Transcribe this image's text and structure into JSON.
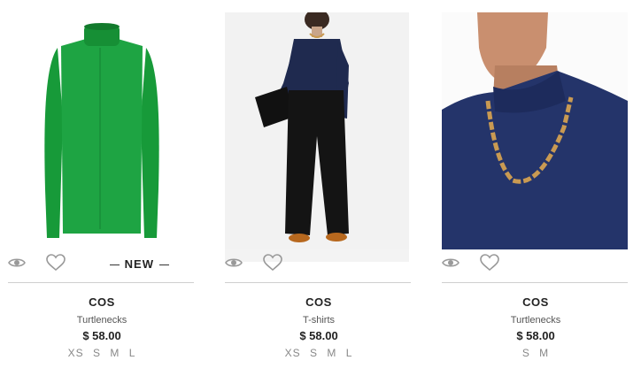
{
  "products": [
    {
      "brand": "COS",
      "category": "Turtlenecks",
      "price": "$ 58.00",
      "badge": "NEW",
      "sizes": [
        "XS",
        "S",
        "M",
        "L"
      ],
      "image": "green-turtleneck-icon"
    },
    {
      "brand": "COS",
      "category": "T-shirts",
      "price": "$ 58.00",
      "badge": "",
      "sizes": [
        "XS",
        "S",
        "M",
        "L"
      ],
      "image": "navy-top-model-icon"
    },
    {
      "brand": "COS",
      "category": "Turtlenecks",
      "price": "$ 58.00",
      "badge": "",
      "sizes": [
        "S",
        "M"
      ],
      "image": "navy-turtleneck-closeup-icon"
    }
  ],
  "colors": {
    "green": "#1a9b3c",
    "navy": "#1f2a4f",
    "gold": "#c99a52"
  }
}
